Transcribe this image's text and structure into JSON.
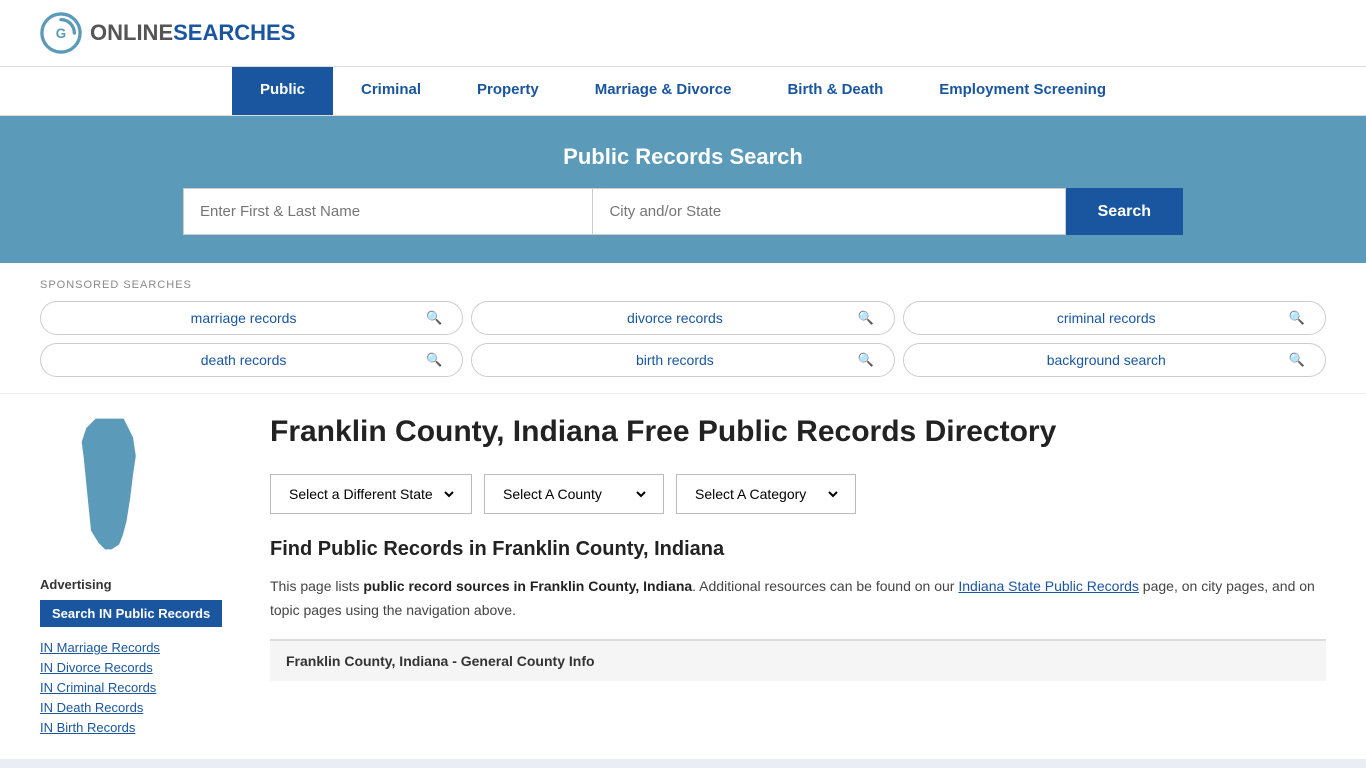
{
  "logo": {
    "online": "ONLINE",
    "searches": "SEARCHES"
  },
  "nav": {
    "items": [
      {
        "label": "Public",
        "active": true
      },
      {
        "label": "Criminal",
        "active": false
      },
      {
        "label": "Property",
        "active": false
      },
      {
        "label": "Marriage & Divorce",
        "active": false
      },
      {
        "label": "Birth & Death",
        "active": false
      },
      {
        "label": "Employment Screening",
        "active": false
      }
    ]
  },
  "search_hero": {
    "title": "Public Records Search",
    "name_placeholder": "Enter First & Last Name",
    "location_placeholder": "City and/or State",
    "search_button": "Search"
  },
  "sponsored": {
    "label": "SPONSORED SEARCHES",
    "items": [
      "marriage records",
      "divorce records",
      "criminal records",
      "death records",
      "birth records",
      "background search"
    ]
  },
  "page_title": "Franklin County, Indiana Free Public Records Directory",
  "dropdowns": {
    "state": "Select a Different State",
    "county": "Select A County",
    "category": "Select A Category"
  },
  "find_records_title": "Find Public Records in Franklin County, Indiana",
  "description": {
    "before": "This page lists ",
    "bold": "public record sources in Franklin County, Indiana",
    "after": ". Additional resources can be found on our ",
    "link_text": "Indiana State Public Records",
    "end": " page, on city pages, and on topic pages using the navigation above."
  },
  "general_info_bar": "Franklin County, Indiana - General County Info",
  "sidebar": {
    "advertising_label": "Advertising",
    "ad_button": "Search IN Public Records",
    "links": [
      "IN Marriage Records",
      "IN Divorce Records",
      "IN Criminal Records",
      "IN Death Records",
      "IN Birth Records"
    ]
  }
}
